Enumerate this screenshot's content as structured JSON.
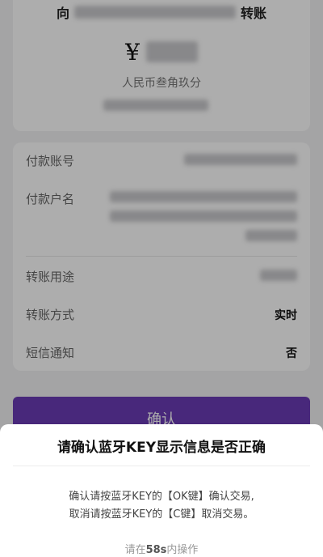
{
  "transfer": {
    "to_prefix": "向",
    "to_suffix": "转账",
    "currency_symbol": "¥",
    "amount_words": "人民币叁角玖分"
  },
  "details": {
    "payer_account_label": "付款账号",
    "payer_name_label": "付款户名",
    "purpose_label": "转账用途",
    "method_label": "转账方式",
    "method_value": "实时",
    "sms_label": "短信通知",
    "sms_value": "否"
  },
  "confirm_button": {
    "label": "确认"
  },
  "dialog": {
    "title": "请确认蓝牙KEY显示信息是否正确",
    "line1": "确认请按蓝牙KEY的【OK键】确认交易,",
    "line2": "取消请按蓝牙KEY的【C键】取消交易。",
    "countdown_prefix": "请在",
    "countdown_value": "58s",
    "countdown_suffix": "内操作"
  },
  "colors": {
    "accent": "#6a3bb5",
    "overlay": "rgba(0,0,0,0.32)"
  }
}
